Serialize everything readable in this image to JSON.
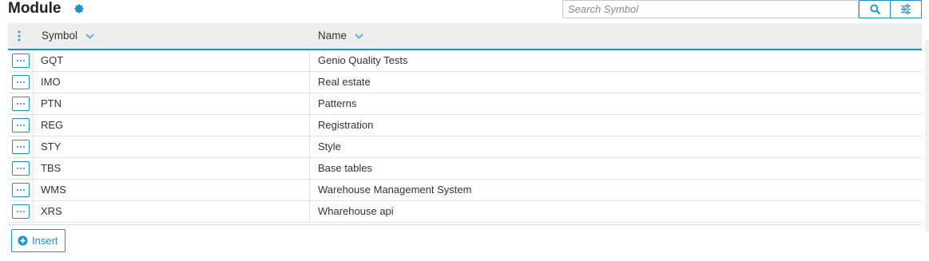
{
  "header": {
    "title": "Module",
    "settings_icon": "gear-icon"
  },
  "search": {
    "placeholder": "Search Symbol",
    "search_icon": "search-icon",
    "filter_icon": "sliders-icon"
  },
  "table": {
    "columns": [
      {
        "label": "Symbol",
        "sort_icon": "chevron-down-icon"
      },
      {
        "label": "Name",
        "sort_icon": "chevron-down-icon"
      }
    ],
    "rows": [
      {
        "symbol": "GQT",
        "name": "Genio Quality Tests"
      },
      {
        "symbol": "IMO",
        "name": "Real estate"
      },
      {
        "symbol": "PTN",
        "name": "Patterns"
      },
      {
        "symbol": "REG",
        "name": "Registration"
      },
      {
        "symbol": "STY",
        "name": "Style"
      },
      {
        "symbol": "TBS",
        "name": "Base tables"
      },
      {
        "symbol": "WMS",
        "name": "Warehouse Management System"
      },
      {
        "symbol": "XRS",
        "name": "Wharehouse api"
      }
    ]
  },
  "footer": {
    "insert_label": "Insert",
    "insert_icon": "plus-circle-icon"
  },
  "colors": {
    "accent": "#1f8fd0",
    "header_bg": "#eeeeee"
  }
}
